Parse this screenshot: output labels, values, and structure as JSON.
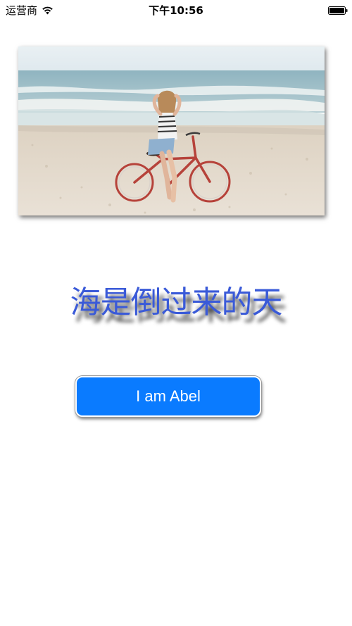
{
  "status_bar": {
    "carrier": "运营商",
    "time": "下午10:56",
    "wifi_icon": "wifi-icon",
    "battery_icon": "battery-icon"
  },
  "photo": {
    "subject": "woman-with-bicycle-on-beach"
  },
  "title": {
    "text": "海是倒过来的天",
    "color": "#3a5ad8"
  },
  "button": {
    "label": "I am Abel",
    "color": "#0a7bff"
  }
}
